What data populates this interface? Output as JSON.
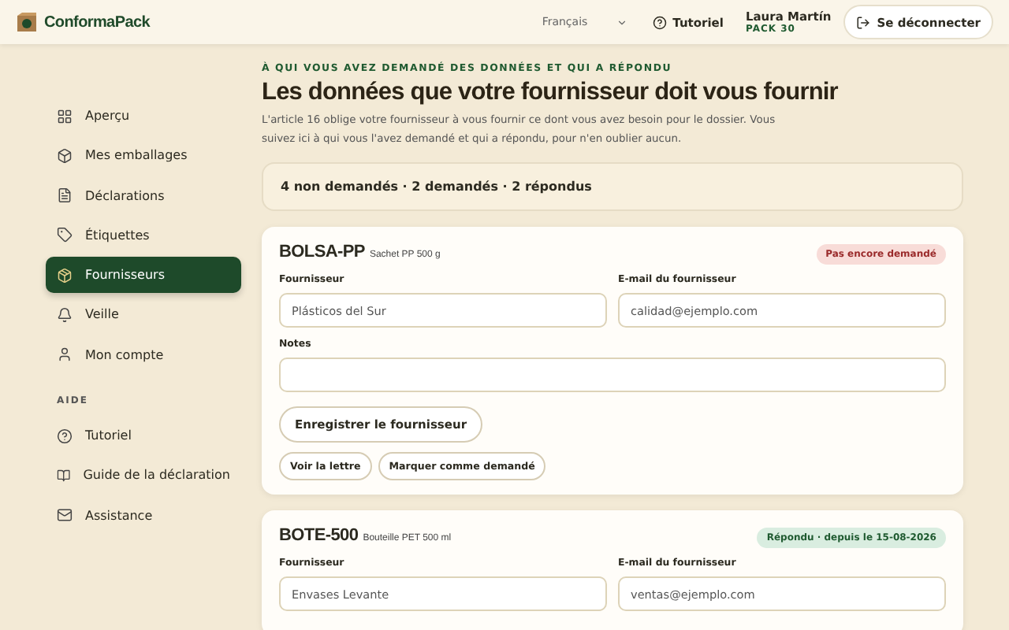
{
  "header": {
    "brand": "ConformaPack",
    "language": "Français",
    "tutorial": "Tutoriel",
    "user": {
      "name": "Laura Martín",
      "plan": "PACK 30"
    },
    "logout": "Se déconnecter"
  },
  "sidebar": {
    "items": [
      {
        "label": "Aperçu",
        "selected": false
      },
      {
        "label": "Mes emballages",
        "selected": false
      },
      {
        "label": "Déclarations",
        "selected": false
      },
      {
        "label": "Étiquettes",
        "selected": false
      },
      {
        "label": "Fournisseurs",
        "selected": true
      },
      {
        "label": "Veille",
        "selected": false
      },
      {
        "label": "Mon compte",
        "selected": false
      }
    ],
    "help_heading": "AIDE",
    "help_items": [
      {
        "label": "Tutoriel"
      },
      {
        "label": "Guide de la déclaration"
      },
      {
        "label": "Assistance"
      }
    ]
  },
  "page": {
    "eyebrow": "À QUI VOUS AVEZ DEMANDÉ DES DONNÉES ET QUI A RÉPONDU",
    "title": "Les données que votre fournisseur doit vous fournir",
    "intro": "L'article 16 oblige votre fournisseur à vous fournir ce dont vous avez besoin pour le dossier. Vous suivez ici à qui vous l'avez demandé et qui a répondu, pour n'en oublier aucun.",
    "summary": "4 non demandés · 2 demandés · 2 répondus"
  },
  "cards": [
    {
      "code": "BOLSA-PP",
      "description": "Sachet PP 500 g",
      "status": {
        "kind": "not_requested",
        "label": "Pas encore demandé"
      },
      "supplier_label": "Fournisseur",
      "supplier": "Plásticos del Sur",
      "email_label": "E-mail du fournisseur",
      "email": "calidad@ejemplo.com",
      "notes_label": "Notes",
      "save": "Enregistrer le fournisseur",
      "actions": [
        "Voir la lettre",
        "Marquer comme demandé"
      ]
    },
    {
      "code": "BOTE-500",
      "description": "Bouteille PET 500 ml",
      "status": {
        "kind": "answered",
        "label": "Répondu · depuis le 15-08-2026"
      },
      "supplier_label": "Fournisseur",
      "supplier": "Envases Levante",
      "email_label": "E-mail du fournisseur",
      "email": "ventas@ejemplo.com"
    }
  ]
}
